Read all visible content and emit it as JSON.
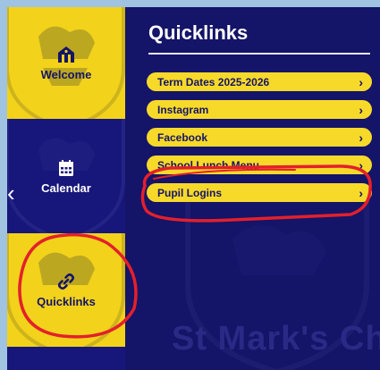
{
  "sidebar": {
    "tiles": [
      {
        "label": "Welcome",
        "icon": "building-icon"
      },
      {
        "label": "Calendar",
        "icon": "calendar-icon"
      },
      {
        "label": "Quicklinks",
        "icon": "link-icon"
      }
    ]
  },
  "quicklinks": {
    "title": "Quicklinks",
    "items": [
      {
        "label": "Term Dates 2025-2026"
      },
      {
        "label": "Instagram"
      },
      {
        "label": "Facebook"
      },
      {
        "label": "School Lunch Menu"
      },
      {
        "label": "Pupil Logins"
      }
    ]
  },
  "watermark": "St Mark's Ch",
  "colors": {
    "navy": "#141468",
    "yellow": "#f2d21a",
    "annotation": "#e3202b"
  }
}
